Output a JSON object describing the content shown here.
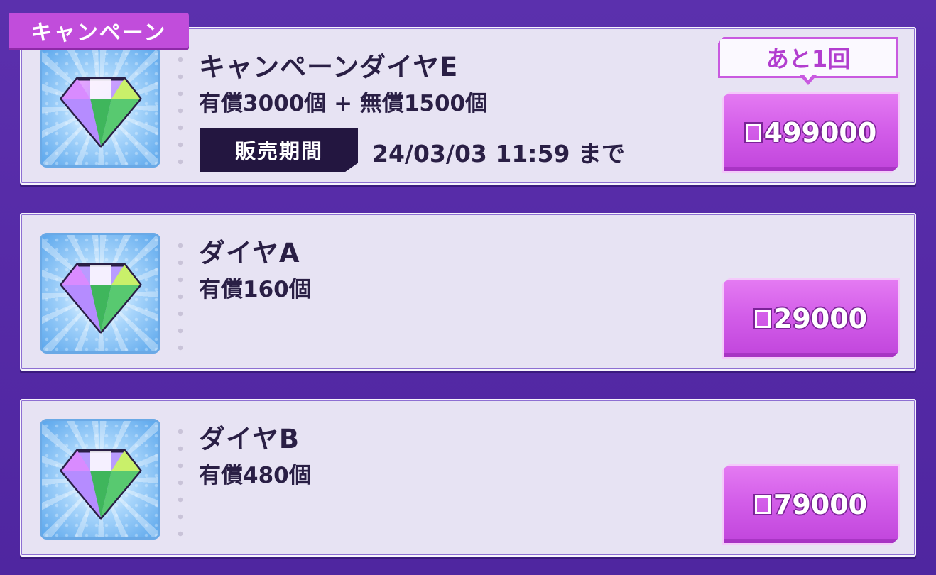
{
  "campaign_tag": "キャンペーン",
  "items": [
    {
      "title": "キャンペーンダイヤE",
      "description": "有償3000個 + 無償1500個",
      "period_label": "販売期間",
      "period_value": "24/03/03 11:59 まで",
      "limit": "あと1回",
      "price": "499000"
    },
    {
      "title": "ダイヤA",
      "description": "有償160個",
      "price": "29000"
    },
    {
      "title": "ダイヤB",
      "description": "有償480個",
      "price": "79000"
    }
  ],
  "icons": {
    "gem": "diamond-gem-icon",
    "currency": "currency-square-icon"
  }
}
